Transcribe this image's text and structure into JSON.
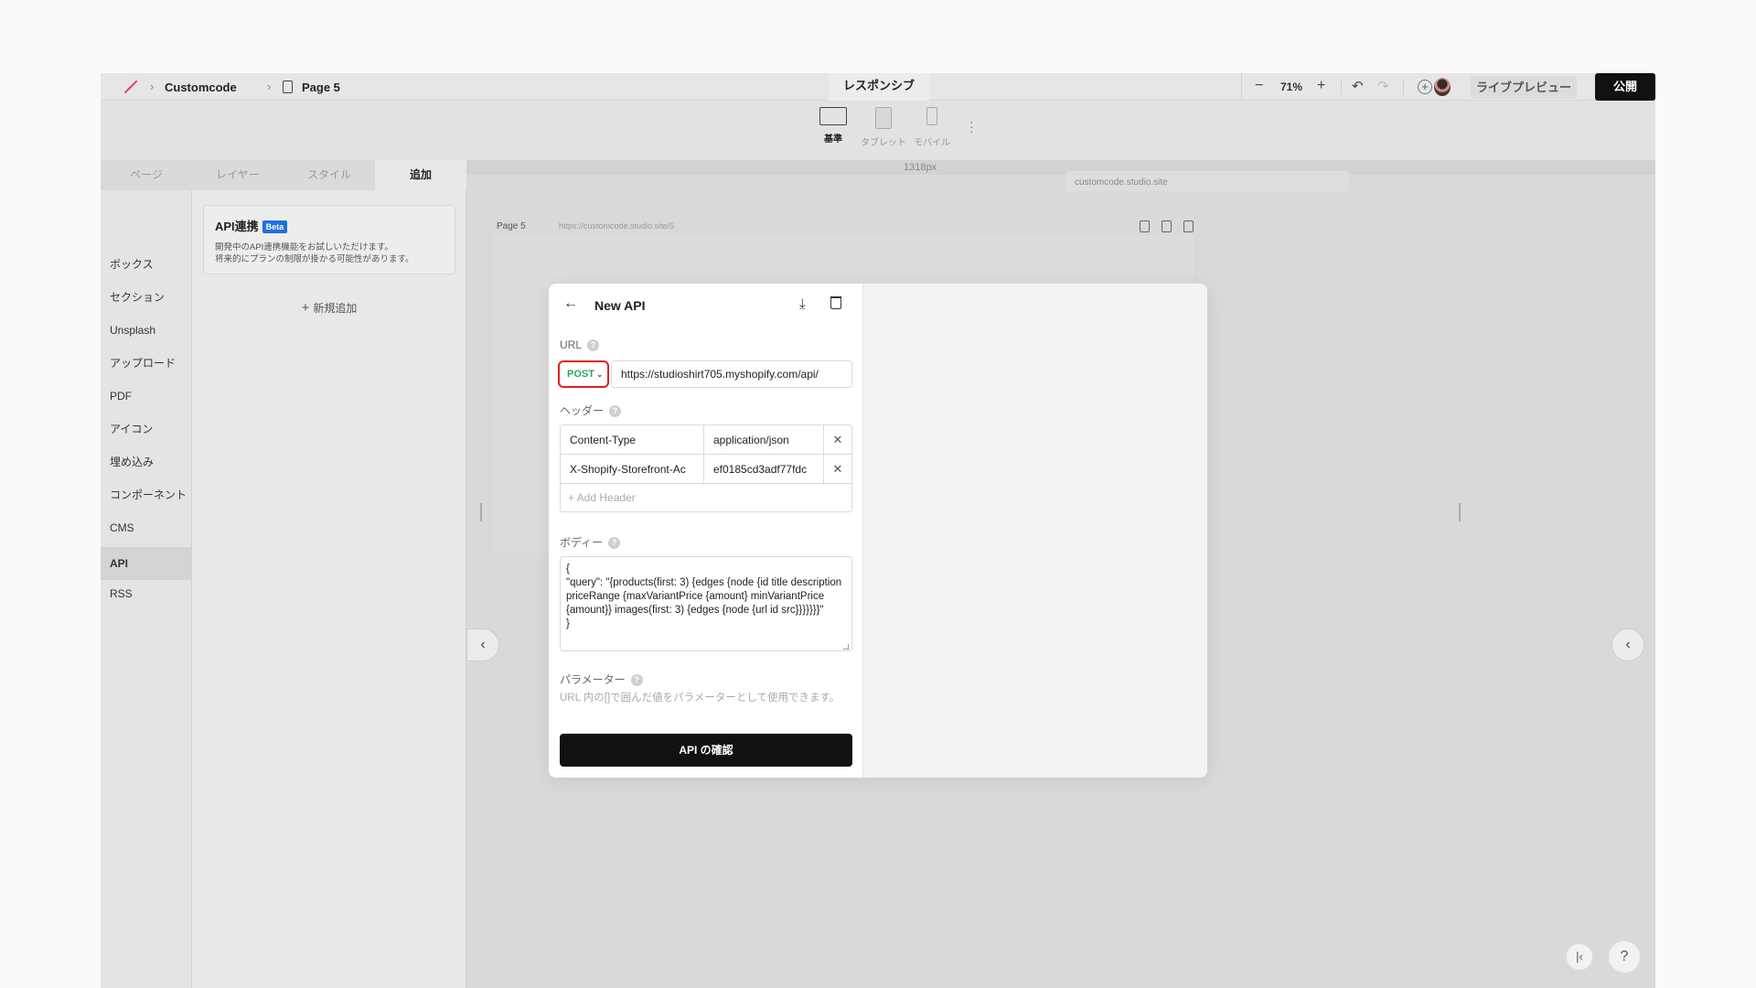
{
  "topbar": {
    "breadcrumb": [
      "Customcode",
      "Page 5"
    ],
    "center_tab": "レスポンシブ",
    "zoom": "71%",
    "live_preview": "ライブプレビュー",
    "publish": "公開"
  },
  "devices": [
    {
      "label": "基準",
      "active": true
    },
    {
      "label": "タブレット",
      "active": false
    },
    {
      "label": "モバイル",
      "active": false
    }
  ],
  "sidebar": {
    "tabs": [
      "ページ",
      "レイヤー",
      "スタイル",
      "追加"
    ],
    "active_tab": "追加",
    "nav": [
      "ボックス",
      "セクション",
      "Unsplash",
      "アップロード",
      "PDF",
      "アイコン",
      "埋め込み",
      "コンポーネント",
      "CMS",
      "API",
      "RSS"
    ],
    "active_nav": "API",
    "card": {
      "title": "API連携",
      "badge": "Beta",
      "desc_line1": "開発中のAPI連携機能をお試しいただけます。",
      "desc_line2": "将来的にプランの制限が掛かる可能性があります。"
    },
    "add_new": "新規追加"
  },
  "canvas": {
    "width_label": "1318px",
    "site_url": "customcode.studio.site",
    "page_label": "Page 5",
    "page_url": "https://customcode.studio.site/5"
  },
  "modal": {
    "title": "New API",
    "url_label": "URL",
    "method": "POST",
    "url_value": "https://studioshirt705.myshopify.com/api/",
    "headers_label": "ヘッダー",
    "headers": [
      {
        "key": "Content-Type",
        "value": "application/json"
      },
      {
        "key": "X-Shopify-Storefront-Ac",
        "value": "ef0185cd3adf77fdc"
      }
    ],
    "add_header": "+ Add Header",
    "body_label": "ボディー",
    "body_value": "{\n\"query\": \"{products(first: 3) {edges {node {id title description priceRange {maxVariantPrice {amount} minVariantPrice {amount}} images(first: 3) {edges {node {url id src}}}}}}}\"\n}",
    "params_label": "パラメーター",
    "params_desc": "URL 内の[]で囲んだ値をパラメーターとして使用できます。",
    "confirm_button": "API の確認"
  },
  "corner": {
    "help": "?"
  },
  "colors": {
    "accent_beta": "#1f6fe0",
    "method_green": "#2aa65a",
    "highlight_red": "#e02020",
    "publish_bg": "#111111"
  }
}
